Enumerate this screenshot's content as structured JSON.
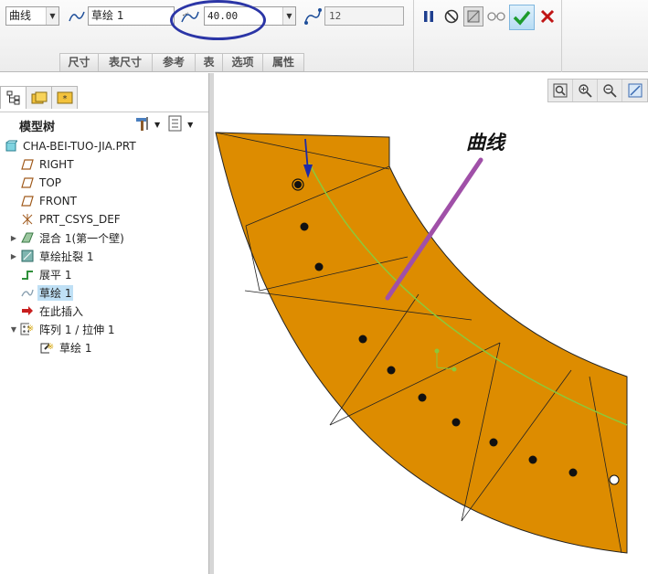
{
  "dashboard": {
    "type_value": "曲线",
    "sketch_value": "草绘 1",
    "value_field": "40.00",
    "disabled_field": "12",
    "tabs": [
      "尺寸",
      "表尺寸",
      "参考",
      "表",
      "选项",
      "属性"
    ],
    "confirm_color": "#1d9b2d",
    "cancel_color": "#c01515"
  },
  "navigator": {
    "tabs": [
      "model-tree-icon",
      "folder-icon",
      "favorites-icon"
    ]
  },
  "model_tree": {
    "title": "模型树",
    "items": [
      {
        "label": "CHA-BEI-TUO-JIA.PRT",
        "icon": "part-icon",
        "level": 0,
        "toggle": ""
      },
      {
        "label": "RIGHT",
        "icon": "datum-plane-icon",
        "level": 1,
        "toggle": ""
      },
      {
        "label": "TOP",
        "icon": "datum-plane-icon",
        "level": 1,
        "toggle": ""
      },
      {
        "label": "FRONT",
        "icon": "datum-plane-icon",
        "level": 1,
        "toggle": ""
      },
      {
        "label": "PRT_CSYS_DEF",
        "icon": "csys-icon",
        "level": 1,
        "toggle": ""
      },
      {
        "label": "混合 1(第一个壁)",
        "icon": "blend-icon",
        "level": 1,
        "toggle": "▶"
      },
      {
        "label": "草绘扯裂 1",
        "icon": "rip-icon",
        "level": 1,
        "toggle": "▶"
      },
      {
        "label": "展平 1",
        "icon": "unbend-icon",
        "level": 1,
        "toggle": ""
      },
      {
        "label": "草绘 1",
        "icon": "sketch-icon",
        "level": 1,
        "toggle": "",
        "selected": true
      },
      {
        "label": "在此插入",
        "icon": "insert-here-icon",
        "level": 1,
        "toggle": ""
      },
      {
        "label": "阵列 1 / 拉伸 1",
        "icon": "pattern-icon",
        "level": 1,
        "toggle": "▼"
      },
      {
        "label": "草绘 1",
        "icon": "sketch-edit-icon",
        "level": 2,
        "toggle": ""
      }
    ]
  },
  "view_tools": [
    "refit-icon",
    "zoom-in-icon",
    "zoom-out-icon",
    "repaint-icon"
  ],
  "annotation": {
    "label": "曲线",
    "arrow_color": "#a050a8",
    "ellipse_color": "#2b35a6"
  },
  "colors": {
    "part_fill": "#dd8c00",
    "curve": "#8cc83a",
    "selection_blue": "#bfe0f5"
  }
}
